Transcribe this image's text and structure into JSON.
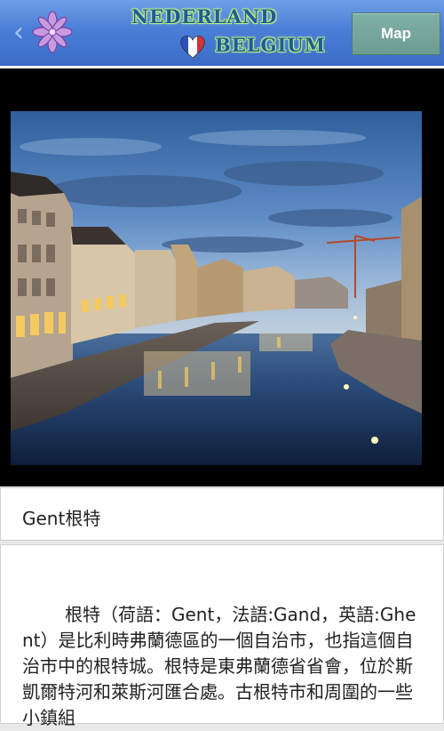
{
  "header": {
    "back_icon": "chevron-left-icon",
    "logo_icon": "purple-star-flower-logo-icon",
    "brand_line1": "NEDERLAND",
    "brand_line2": "BELGIUM",
    "heart_icon": "dutch-flag-heart-icon",
    "map_button_label": "Map",
    "colors": {
      "bar": "#4a7ed7",
      "map_button": "#74a399",
      "brand_text": "#1f5c9c",
      "brand_glow": "#b9f07a"
    }
  },
  "photo": {
    "description_icon": "gent-canal-night-photo"
  },
  "article": {
    "title": "Gent根特",
    "body": "根特（荷語：Gent，法語:Gand，英語:Ghent）是比利時弗蘭德區的一個自治市，也指這個自治市中的根特城。根特是東弗蘭德省省會，位於斯凱爾特河和萊斯河匯合處。古根特市和周圍的一些小鎮組"
  }
}
